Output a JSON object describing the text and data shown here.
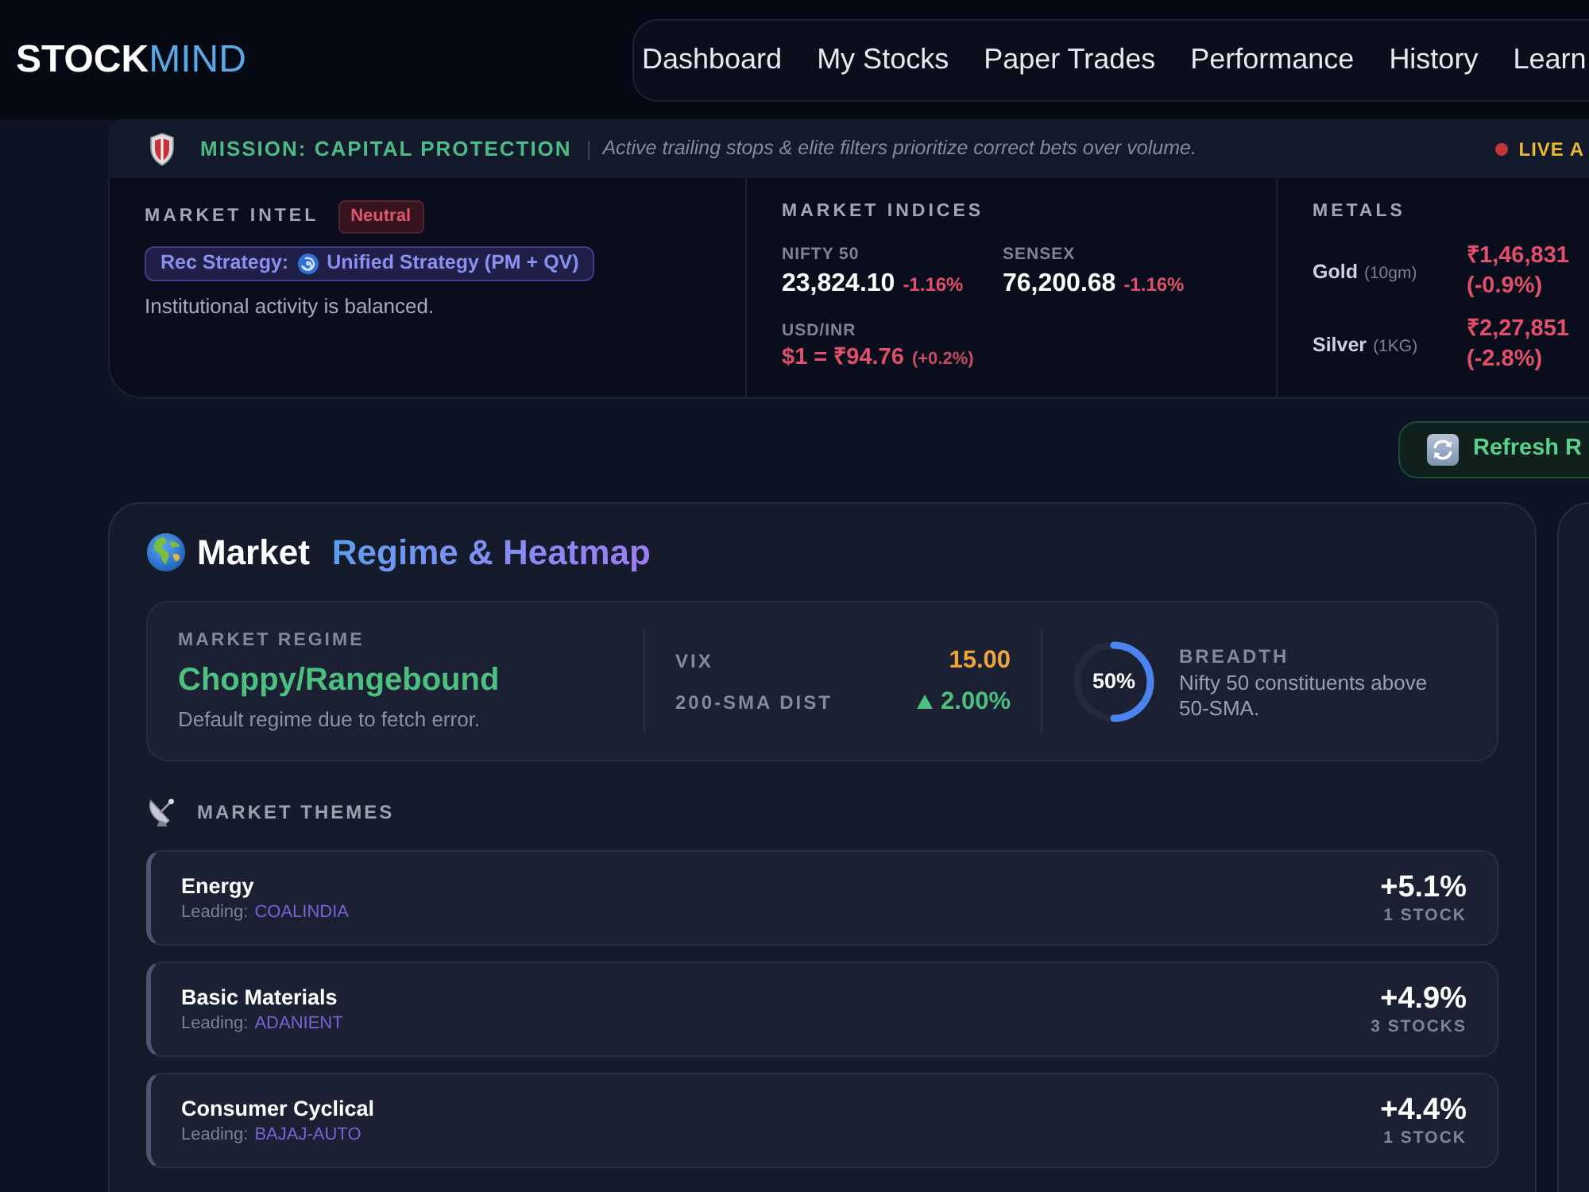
{
  "header": {
    "logo": {
      "part_1": "STOCK",
      "part_2": "MIND"
    },
    "nav": [
      {
        "label": "Dashboard"
      },
      {
        "label": "My Stocks"
      },
      {
        "label": "Paper Trades"
      },
      {
        "label": "Performance"
      },
      {
        "label": "History"
      },
      {
        "label": "Learn"
      }
    ]
  },
  "mission": {
    "title": "MISSION: CAPITAL PROTECTION",
    "separator": "|",
    "text": "Active trailing stops & elite filters prioritize correct bets over volume.",
    "live": "LIVE A"
  },
  "market_intel": {
    "title": "MARKET INTEL",
    "sentiment": "Neutral",
    "strategy_label": "Rec Strategy:",
    "strategy": "Unified Strategy (PM + QV)",
    "note": "Institutional activity is balanced."
  },
  "market_indices": {
    "title": "MARKET INDICES",
    "items": [
      {
        "label": "NIFTY 50",
        "value": "23,824.10",
        "change": "-1.16%"
      },
      {
        "label": "SENSEX",
        "value": "76,200.68",
        "change": "-1.16%"
      }
    ],
    "fx": {
      "label": "USD/INR",
      "value": "$1 = ₹94.76",
      "change": "(+0.2%)"
    }
  },
  "metals": {
    "title": "METALS",
    "items": [
      {
        "name": "Gold",
        "unit": "(10gm)",
        "price": "₹1,46,831",
        "change": "(-0.9%)"
      },
      {
        "name": "Silver",
        "unit": "(1KG)",
        "price": "₹2,27,851",
        "change": "(-2.8%)"
      }
    ]
  },
  "refresh_button": {
    "label": "Refresh R"
  },
  "market_card": {
    "title": "Market",
    "subtitle": "Regime & Heatmap",
    "regime": {
      "label": "MARKET REGIME",
      "value": "Choppy/Rangebound",
      "note": "Default regime due to fetch error."
    },
    "stats": [
      {
        "label": "VIX",
        "value": "15.00",
        "kind": "neutral"
      },
      {
        "label": "200-SMA DIST",
        "value": "2.00%",
        "kind": "up"
      }
    ],
    "breadth": {
      "label": "BREADTH",
      "level": 0.5,
      "reading": "50%",
      "note": "Nifty 50 constituents above 50-SMA."
    },
    "themes": {
      "title": "MARKET THEMES",
      "items": [
        {
          "name": "Energy",
          "leading_label": "Leading:",
          "leading": "COALINDIA",
          "change": "+5.1%",
          "count": "1 STOCK"
        },
        {
          "name": "Basic Materials",
          "leading_label": "Leading:",
          "leading": "ADANIENT",
          "change": "+4.9%",
          "count": "3 STOCKS"
        },
        {
          "name": "Consumer Cyclical",
          "leading_label": "Leading:",
          "leading": "BAJAJ-AUTO",
          "change": "+4.4%",
          "count": "1 STOCK"
        }
      ]
    }
  }
}
